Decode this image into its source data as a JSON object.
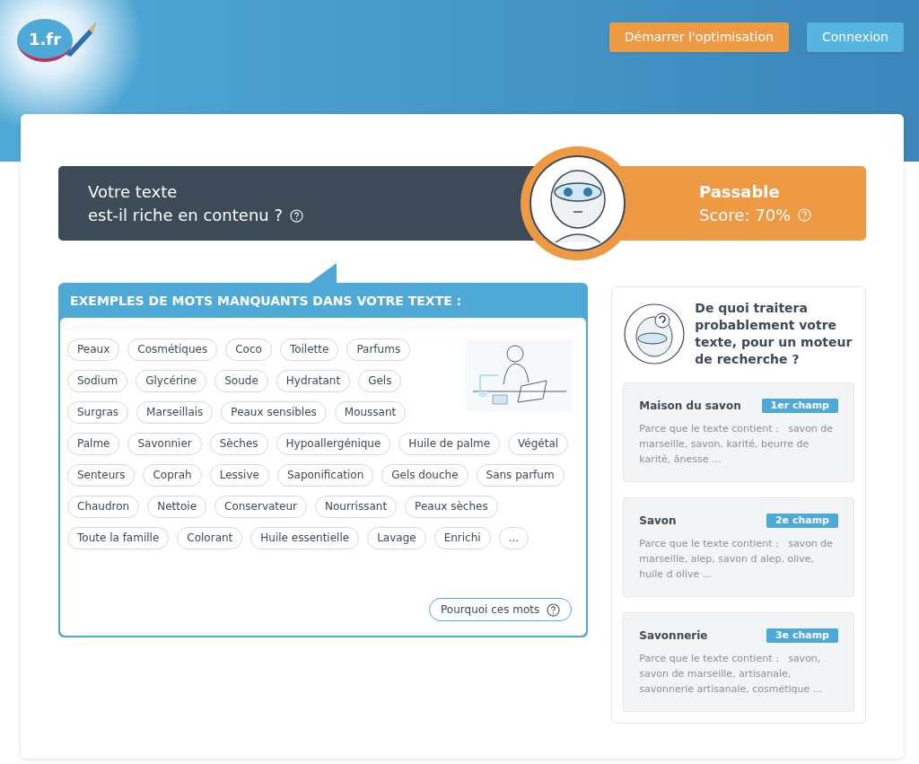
{
  "header": {
    "logo_text": "1.fr",
    "buttons": [
      {
        "label": "Démarrer l'optimisation",
        "kind": "primary"
      },
      {
        "label": "Connexion",
        "kind": "secondary"
      }
    ]
  },
  "banner": {
    "question_lines": [
      "Votre texte",
      "est-il riche en contenu ?"
    ],
    "verdict": "Passable",
    "score": "Score: 70%"
  },
  "missing_words": {
    "title": "EXEMPLES DE MOTS MANQUANTS DANS VOTRE TEXTE :",
    "words": [
      "Peaux",
      "Cosmétiques",
      "Coco",
      "Toilette",
      "Parfums",
      "Sodium",
      "Glycérine",
      "Soude",
      "Hydratant",
      "Gels",
      "Surgras",
      "Marseillais",
      "Peaux sensibles",
      "Moussant",
      "Palme",
      "Savonnier",
      "Sèches",
      "Hypoallergénique",
      "Huile de palme",
      "Végétal",
      "Senteurs",
      "Coprah",
      "Lessive",
      "Saponification",
      "Gels douche",
      "Sans parfum",
      "Chaudron",
      "Nettoie",
      "Conservateur",
      "Nourrissant",
      "Peaux sèches",
      "Toute la famille",
      "Colorant",
      "Huile essentielle",
      "Lavage",
      "Enrichi",
      "..."
    ],
    "why_button": "Pourquoi ces mots"
  },
  "topics": {
    "title": "De quoi traitera probablement votre texte, pour un moteur de recherche ?",
    "items": [
      {
        "name": "Maison du savon",
        "rank": "1er champ",
        "reason": "Parce que le texte contient :   savon de marseille, savon, karité, beurre de karité, ânesse ..."
      },
      {
        "name": "Savon",
        "rank": "2e champ",
        "reason": "Parce que le texte contient :   savon de marseille, alep, savon d alep, olive, huile d olive ..."
      },
      {
        "name": "Savonnerie",
        "rank": "3e champ",
        "reason": "Parce que le texte contient :   savon, savon de marseille, artisanale, savonnerie artisanale, cosmétique ..."
      }
    ]
  }
}
